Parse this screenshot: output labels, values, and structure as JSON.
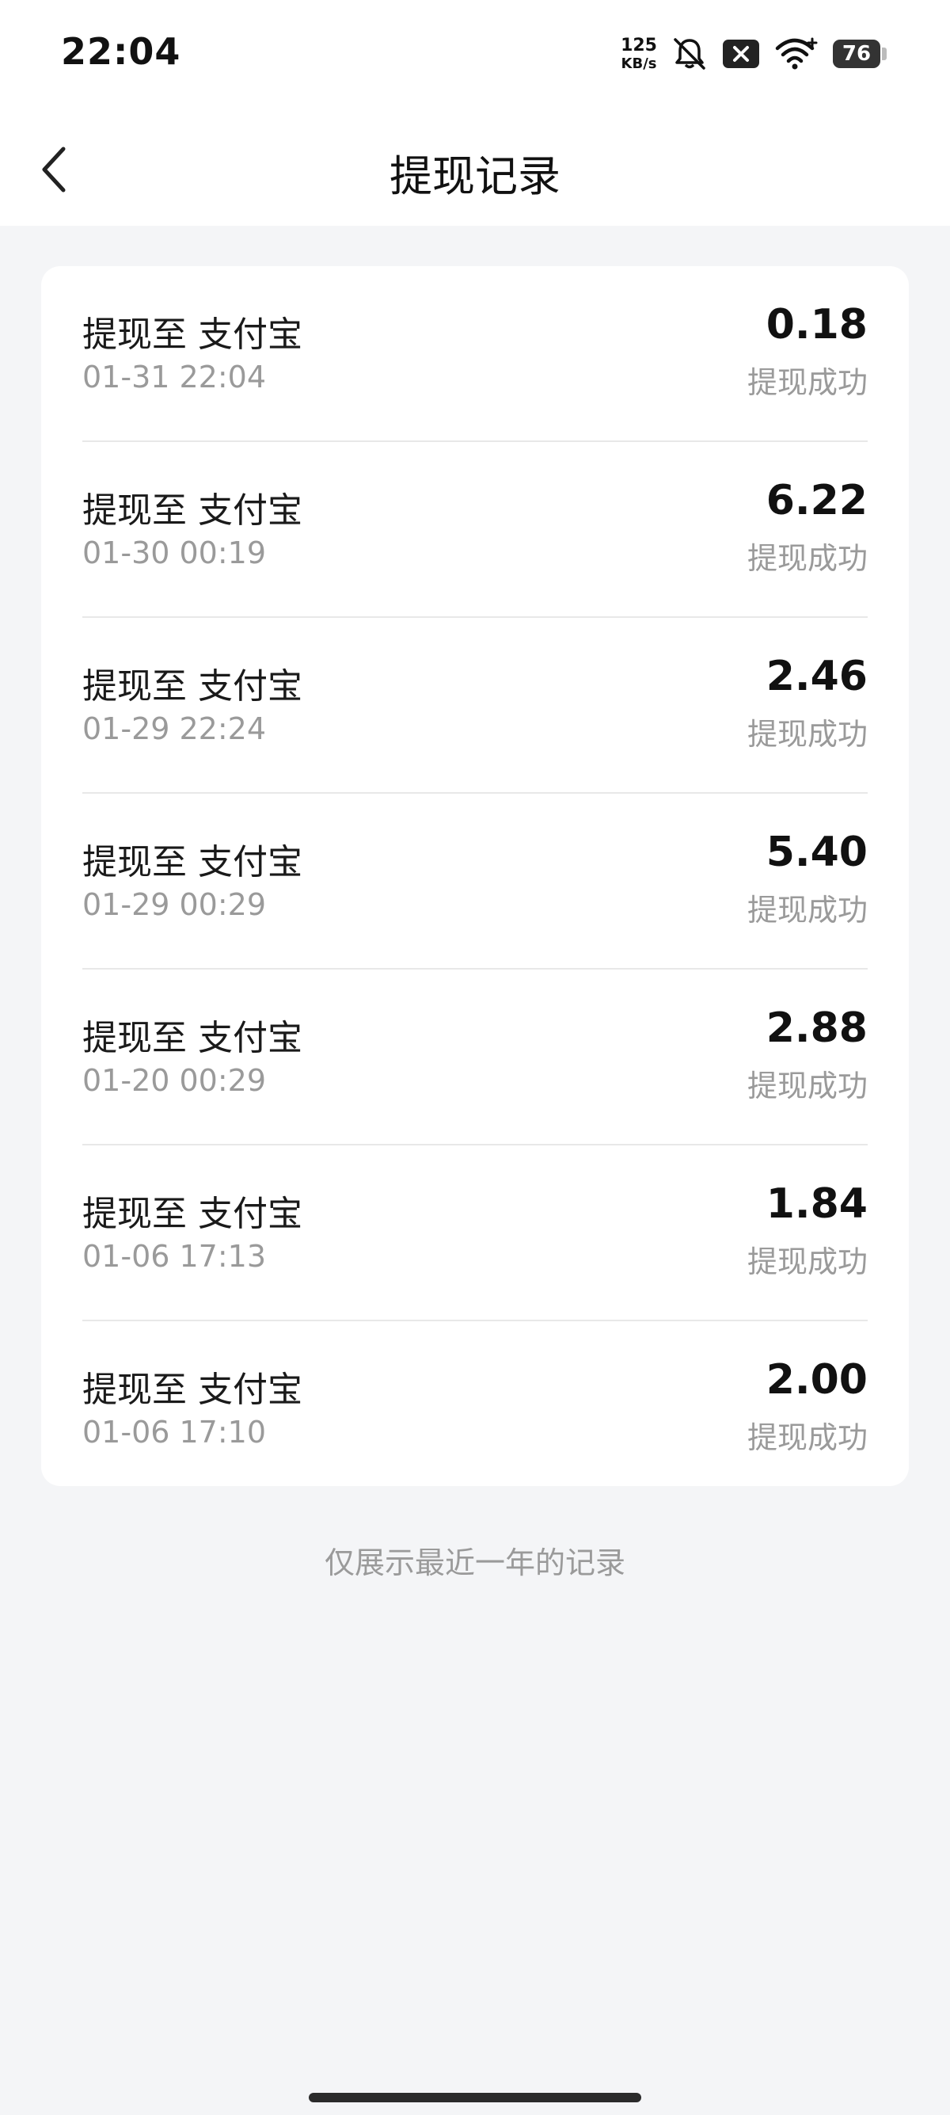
{
  "status_bar": {
    "time": "22:04",
    "net_speed_value": "125",
    "net_speed_unit": "KB/s",
    "battery": "76",
    "icons": [
      "silent-bell-icon",
      "sim-x-icon",
      "wifi-icon",
      "battery-icon"
    ]
  },
  "header": {
    "back_icon": "chevron-left-icon",
    "title": "提现记录"
  },
  "records": [
    {
      "title": "提现至 支付宝",
      "time": "01-31 22:04",
      "amount": "0.18",
      "status": "提现成功"
    },
    {
      "title": "提现至 支付宝",
      "time": "01-30 00:19",
      "amount": "6.22",
      "status": "提现成功"
    },
    {
      "title": "提现至 支付宝",
      "time": "01-29 22:24",
      "amount": "2.46",
      "status": "提现成功"
    },
    {
      "title": "提现至 支付宝",
      "time": "01-29 00:29",
      "amount": "5.40",
      "status": "提现成功"
    },
    {
      "title": "提现至 支付宝",
      "time": "01-20 00:29",
      "amount": "2.88",
      "status": "提现成功"
    },
    {
      "title": "提现至 支付宝",
      "time": "01-06 17:13",
      "amount": "1.84",
      "status": "提现成功"
    },
    {
      "title": "提现至 支付宝",
      "time": "01-06 17:10",
      "amount": "2.00",
      "status": "提现成功"
    }
  ],
  "footnote": "仅展示最近一年的记录",
  "colors": {
    "background": "#f4f5f7",
    "card": "#ffffff",
    "secondary_text": "#9a9a9a",
    "divider": "#e8e8e8"
  }
}
